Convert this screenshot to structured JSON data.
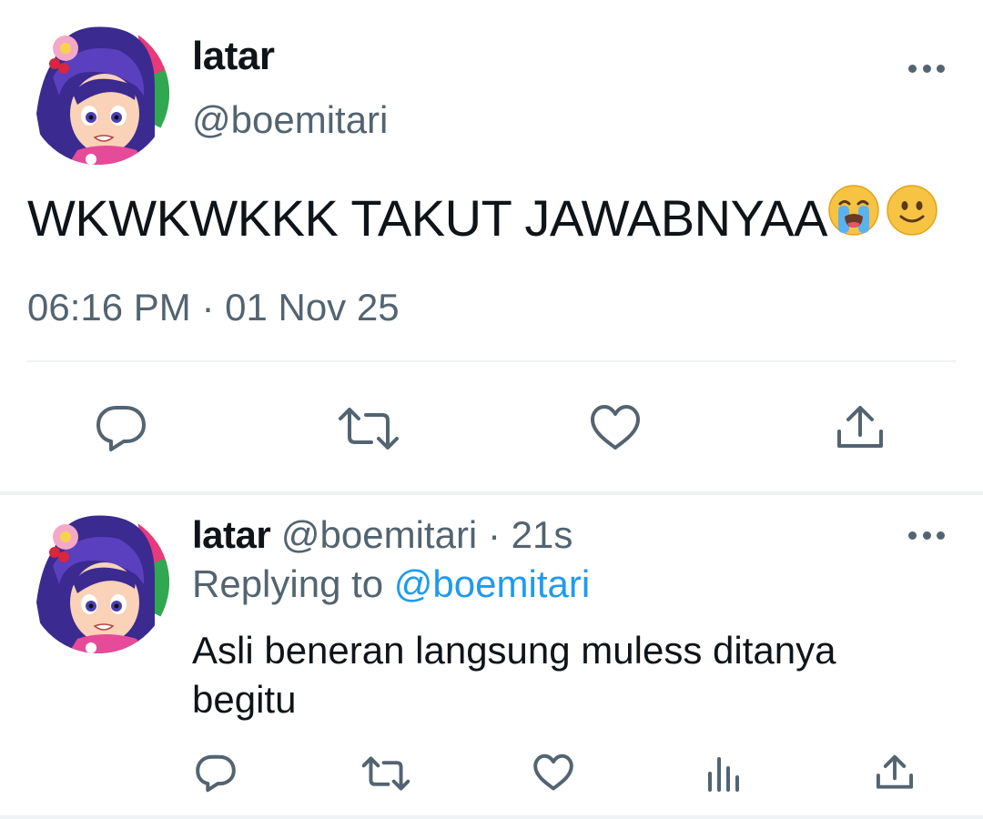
{
  "main_tweet": {
    "author_name": "latar",
    "handle": "@boemitari",
    "text": "WKWKWKKK TAKUT JAWABNYAA",
    "emojis": [
      "loudly-crying-face-emoji",
      "slightly-smiling-face-emoji"
    ],
    "timestamp": "06:16 PM · 01 Nov 25",
    "actions": [
      "reply-icon",
      "retweet-icon",
      "like-icon",
      "share-icon"
    ]
  },
  "reply_tweet": {
    "author_name": "latar",
    "handle": "@boemitari",
    "separator": "·",
    "time_ago": "21s",
    "replying_label": "Replying to",
    "replying_to": "@boemitari",
    "text": "Asli beneran langsung muless ditanya begitu",
    "actions": [
      "reply-icon",
      "retweet-icon",
      "like-icon",
      "analytics-icon",
      "share-icon"
    ]
  },
  "colors": {
    "text_primary": "#0f1419",
    "text_secondary": "#536471",
    "accent": "#1d9bf0",
    "divider": "#eff3f4"
  }
}
